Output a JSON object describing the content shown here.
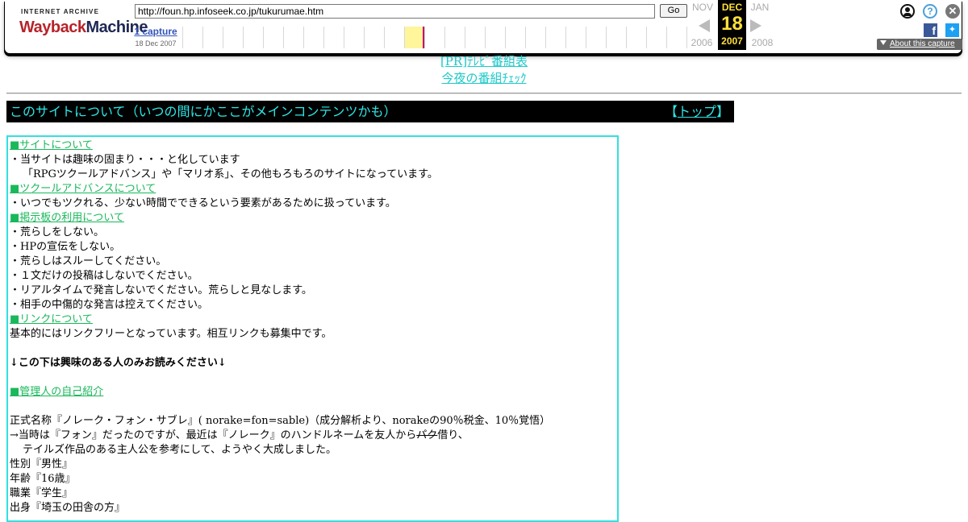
{
  "toolbar": {
    "logo_top": "INTERNET ARCHIVE",
    "logo_wayback": "Wayback",
    "logo_machine": "Machine",
    "url": "http://foun.hp.infoseek.co.jp/tukurumae.htm",
    "go_label": "Go",
    "captures_count": "1 capture",
    "captures_date": "18 Dec 2007",
    "prev_month": "NOV",
    "cur_month": "DEC",
    "next_month": "JAN",
    "cur_day": "18",
    "prev_year": "2006",
    "cur_year": "2007",
    "next_year": "2008",
    "about_label": "About this capture",
    "colors": {
      "current_bg": "#000000",
      "current_text": "#ffe03a",
      "highlight": "#fff59b",
      "capture_mark": "#c2006b"
    }
  },
  "ads": {
    "link1": "[PR]ﾃﾚﾋﾞ番組表",
    "link2": "今夜の番組ﾁｪｯｸ"
  },
  "header": {
    "title": "このサイトについて（いつの間にかここがメインコンテンツかも）",
    "top_open": "【",
    "top_link": "トップ",
    "top_close": "】"
  },
  "content": {
    "sec_site": "■サイトについて",
    "site_1": "・当サイトは趣味の固まり・・・と化しています",
    "site_2": "「RPGツクールアドバンス」や「マリオ系」、その他もろもろのサイトになっています。",
    "sec_tsukuru": "■ツクールアドバンスについて",
    "tsukuru_1": "・いつでもツクれる、少ない時間でできるという要素があるために扱っています。",
    "sec_bbs": "■掲示板の利用について",
    "bbs_1": "・荒らしをしない。",
    "bbs_2": "・HPの宣伝をしない。",
    "bbs_3": "・荒らしはスルーしてください。",
    "bbs_4": "・１文だけの投稿はしないでください。",
    "bbs_5": "・リアルタイムで発言しないでください。荒らしと見なします。",
    "bbs_6": "・相手の中傷的な発言は控えてください。",
    "sec_link": "■リンクについて",
    "link_1": "基本的にはリンクフリーとなっています。相互リンクも募集中です。",
    "notice": "↓この下は興味のある人のみお読みください↓",
    "sec_self": "■管理人の自己紹介",
    "self_name": "正式名称『ノレーク・フォン・サブレ』( norake=fon=sable)（成分解析より、norakeの90％税金、10％覚悟）",
    "self_hist_a": "→当時は『フォン』だったのですが、最近は『ノレーク』のハンドルネームを友人から",
    "self_hist_strike": "パク",
    "self_hist_b": "借り、",
    "self_hist_2": "テイルズ作品のある主人公を参考にして、ようやく大成しました。",
    "self_sex": "性別『男性』",
    "self_age": "年齢『16歳』",
    "self_job": "職業『学生』",
    "self_from": "出身『埼玉の田舎の方』"
  }
}
